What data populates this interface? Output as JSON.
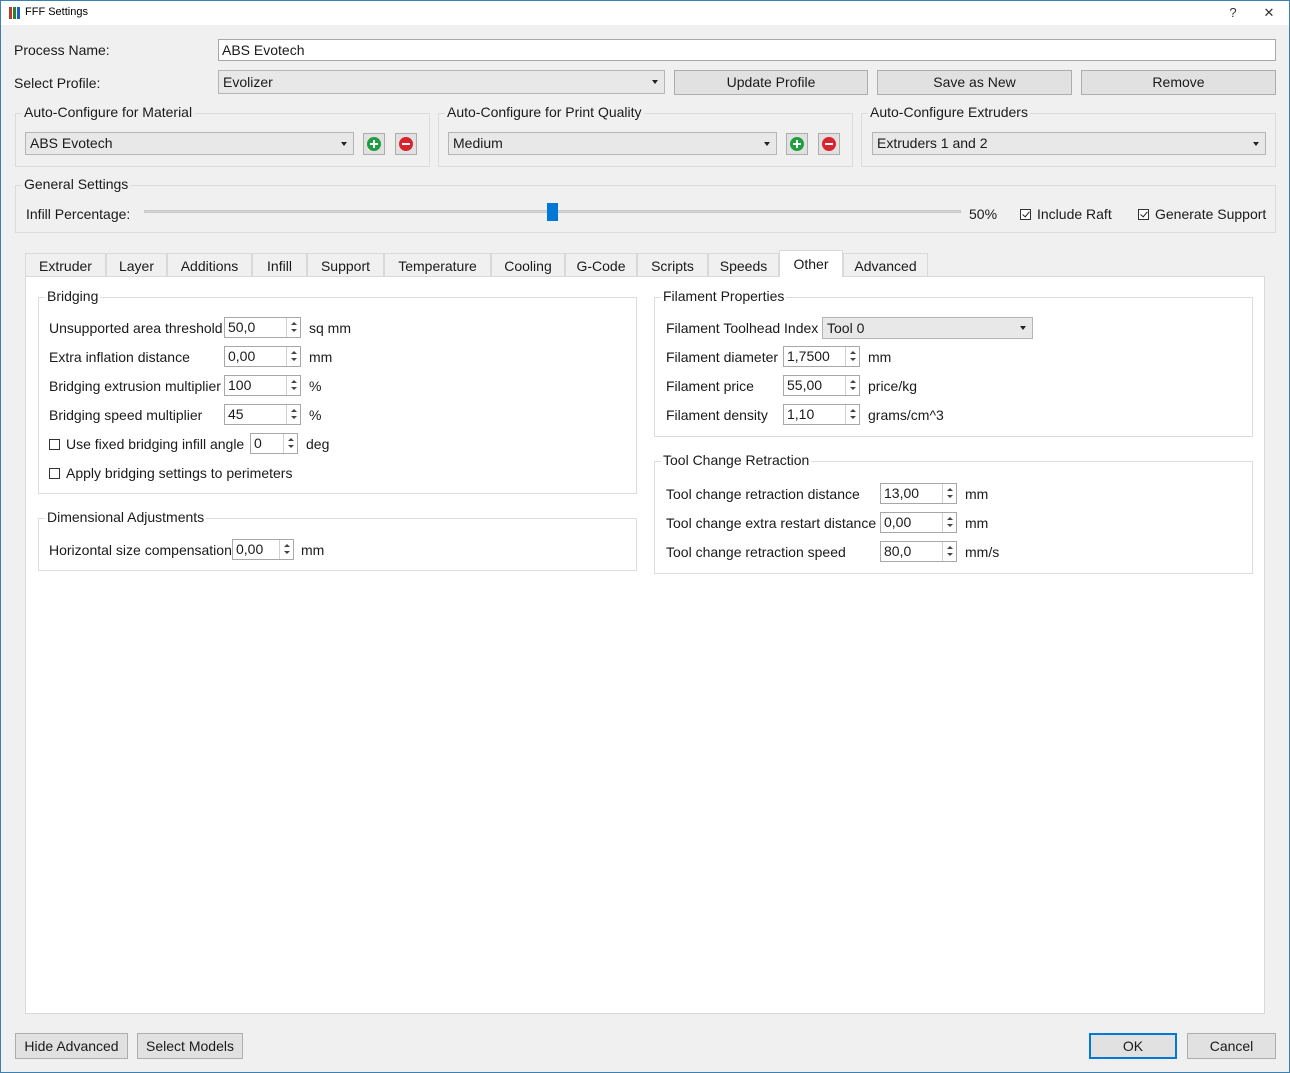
{
  "window": {
    "title": "FFF Settings",
    "help": "?",
    "close": "✕"
  },
  "process": {
    "name_label": "Process Name:",
    "name_value": "ABS Evotech"
  },
  "profile": {
    "label": "Select Profile:",
    "value": "Evolizer",
    "update": "Update Profile",
    "save_new": "Save as New",
    "remove": "Remove"
  },
  "auto_material": {
    "title": "Auto-Configure for Material",
    "value": "ABS Evotech"
  },
  "auto_quality": {
    "title": "Auto-Configure for Print Quality",
    "value": "Medium"
  },
  "auto_extruders": {
    "title": "Auto-Configure Extruders",
    "value": "Extruders 1 and 2"
  },
  "general": {
    "title": "General Settings",
    "infill_label": "Infill Percentage:",
    "infill_value": "50%",
    "infill_fraction": 0.5,
    "include_raft": "Include Raft",
    "include_raft_checked": true,
    "generate_support": "Generate Support",
    "generate_support_checked": true
  },
  "tabs": [
    "Extruder",
    "Layer",
    "Additions",
    "Infill",
    "Support",
    "Temperature",
    "Cooling",
    "G-Code",
    "Scripts",
    "Speeds",
    "Other",
    "Advanced"
  ],
  "active_tab": "Other",
  "bridging": {
    "title": "Bridging",
    "unsupported_label": "Unsupported area threshold",
    "unsupported_value": "50,0",
    "unsupported_unit": "sq mm",
    "inflation_label": "Extra inflation distance",
    "inflation_value": "0,00",
    "inflation_unit": "mm",
    "extrusion_label": "Bridging extrusion multiplier",
    "extrusion_value": "100",
    "extrusion_unit": "%",
    "speed_label": "Bridging speed multiplier",
    "speed_value": "45",
    "speed_unit": "%",
    "fixed_angle_label": "Use fixed bridging infill angle",
    "fixed_angle_value": "0",
    "fixed_angle_unit": "deg",
    "perimeters_label": "Apply bridging settings to perimeters"
  },
  "dimensional": {
    "title": "Dimensional Adjustments",
    "hsize_label": "Horizontal size compensation",
    "hsize_value": "0,00",
    "hsize_unit": "mm"
  },
  "filament": {
    "title": "Filament Properties",
    "toolhead_label": "Filament Toolhead Index",
    "toolhead_value": "Tool 0",
    "diameter_label": "Filament diameter",
    "diameter_value": "1,7500",
    "diameter_unit": "mm",
    "price_label": "Filament price",
    "price_value": "55,00",
    "price_unit": "price/kg",
    "density_label": "Filament density",
    "density_value": "1,10",
    "density_unit": "grams/cm^3"
  },
  "tool_change": {
    "title": "Tool Change Retraction",
    "distance_label": "Tool change retraction distance",
    "distance_value": "13,00",
    "distance_unit": "mm",
    "restart_label": "Tool change extra restart distance",
    "restart_value": "0,00",
    "restart_unit": "mm",
    "speed_label": "Tool change retraction speed",
    "speed_value": "80,0",
    "speed_unit": "mm/s"
  },
  "footer": {
    "hide_advanced": "Hide Advanced",
    "select_models": "Select Models",
    "ok": "OK",
    "cancel": "Cancel"
  },
  "colors": {
    "accent": "#0078d7",
    "add": "#1e9e3e",
    "remove": "#d9232e"
  }
}
